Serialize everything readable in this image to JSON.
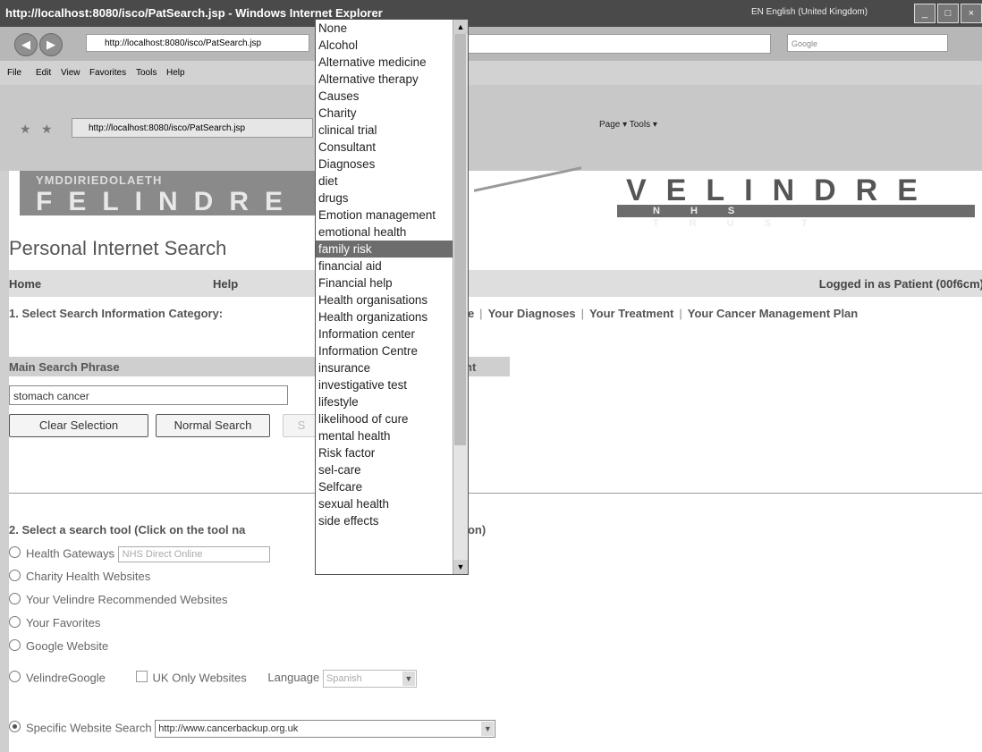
{
  "browser": {
    "title": "http://localhost:8080/isco/PatSearch.jsp - Windows Internet Explorer",
    "language_indicator": "EN English (United Kingdom)",
    "address": "http://localhost:8080/isco/PatSearch.jsp",
    "search_placeholder": "Google",
    "menu": [
      "File",
      "Edit",
      "View",
      "Favorites",
      "Tools",
      "Help"
    ],
    "tab_label": "http://localhost:8080/isco/PatSearch.jsp",
    "toolbar_text": "Page ▾   Tools ▾"
  },
  "banner": {
    "welsh_small": "YMDDIRIEDOLAETH",
    "felindre": "FELINDRE",
    "velindre": "VELINDRE",
    "nhs_trust": "NHS TRUST"
  },
  "page": {
    "title": "Personal Internet Search",
    "nav_home": "Home",
    "nav_help": "Help",
    "logged_in": "Logged in as Patient (00f6cm)",
    "section1_label": "1. Select Search Information Category:",
    "category_tabs": [
      "ne",
      "Your Diagnoses",
      "Your Treatment",
      "Your Cancer Management Plan"
    ],
    "main_search_label": "Main Search Phrase",
    "main_search_right": "nt",
    "main_search_value": "stomach cancer",
    "clear_button": "Clear Selection",
    "normal_search_button": "Normal Search",
    "third_button": "S",
    "section2_label": "2. Select a search tool (Click on the tool na",
    "section2_tail": "tion)",
    "tools": {
      "health_gateways": "Health Gateways",
      "health_gateways_value": "NHS Direct Online",
      "charity": "Charity Health Websites",
      "velindre_recommended": "Your Velindre Recommended Websites",
      "favorites": "Your Favorites",
      "google": "Google Website",
      "velindre_google": "VelindreGoogle",
      "uk_only": "UK Only Websites",
      "language_label": "Language",
      "language_value": "Spanish",
      "specific": "Specific Website Search",
      "specific_value": "http://www.cancerbackup.org.uk"
    }
  },
  "dropdown": {
    "selected": "family risk",
    "items": [
      "None",
      "Alcohol",
      "Alternative medicine",
      "Alternative therapy",
      "Causes",
      "Charity",
      "clinical trial",
      "Consultant",
      "Diagnoses",
      "diet",
      "drugs",
      "Emotion management",
      "emotional health",
      "family risk",
      "financial aid",
      "Financial help",
      "Health organisations",
      "Health organizations",
      "Information center",
      "Information Centre",
      "insurance",
      "investigative test",
      "lifestyle",
      "likelihood of cure",
      "mental health",
      "Risk factor",
      "sel-care",
      "Selfcare",
      "sexual health",
      "side effects"
    ]
  }
}
